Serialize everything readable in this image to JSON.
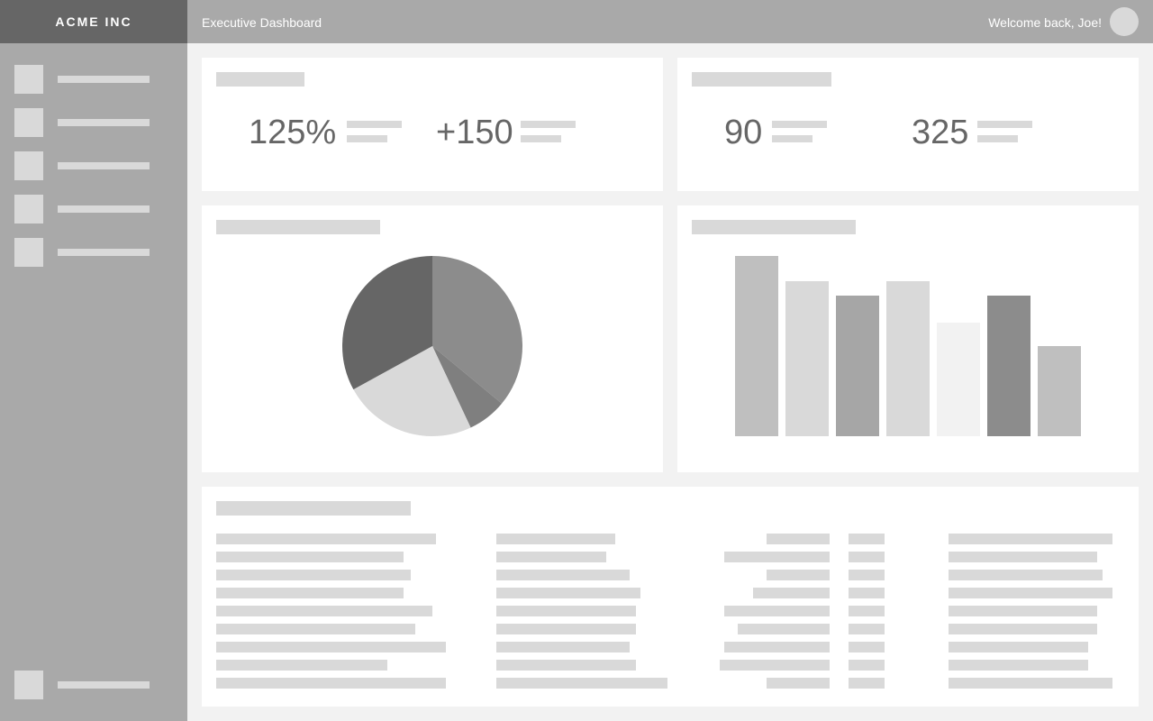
{
  "brand": "ACME INC",
  "header": {
    "title": "Executive Dashboard",
    "welcome": "Welcome back, Joe!"
  },
  "sidebar": {
    "items": [
      {
        "icon": "nav-icon-placeholder"
      },
      {
        "icon": "nav-icon-placeholder"
      },
      {
        "icon": "nav-icon-placeholder"
      },
      {
        "icon": "nav-icon-placeholder"
      },
      {
        "icon": "nav-icon-placeholder"
      }
    ],
    "footer_item": {
      "icon": "nav-icon-placeholder"
    }
  },
  "kpi_cards": [
    {
      "metrics": [
        {
          "value": "125%"
        },
        {
          "value": "+150"
        }
      ]
    },
    {
      "metrics": [
        {
          "value": "90"
        },
        {
          "value": "325"
        }
      ]
    }
  ],
  "colors": {
    "sidebar": "#a9a9a9",
    "brand_bar": "#666666",
    "placeholder": "#d9d9d9",
    "background": "#f2f2f2",
    "card": "#ffffff",
    "metric_text": "#666666"
  },
  "chart_data": [
    {
      "type": "pie",
      "slices": [
        {
          "value": 36,
          "color": "#8c8c8c"
        },
        {
          "value": 7,
          "color": "#7f7f7f"
        },
        {
          "value": 24,
          "color": "#d9d9d9"
        },
        {
          "value": 33,
          "color": "#666666"
        }
      ]
    },
    {
      "type": "bar",
      "values": [
        100,
        86,
        78,
        86,
        63,
        78,
        50
      ],
      "colors": [
        "#bfbfbf",
        "#d9d9d9",
        "#a6a6a6",
        "#d9d9d9",
        "#f2f2f2",
        "#8c8c8c",
        "#bfbfbf"
      ],
      "ylim": [
        0,
        100
      ]
    }
  ]
}
